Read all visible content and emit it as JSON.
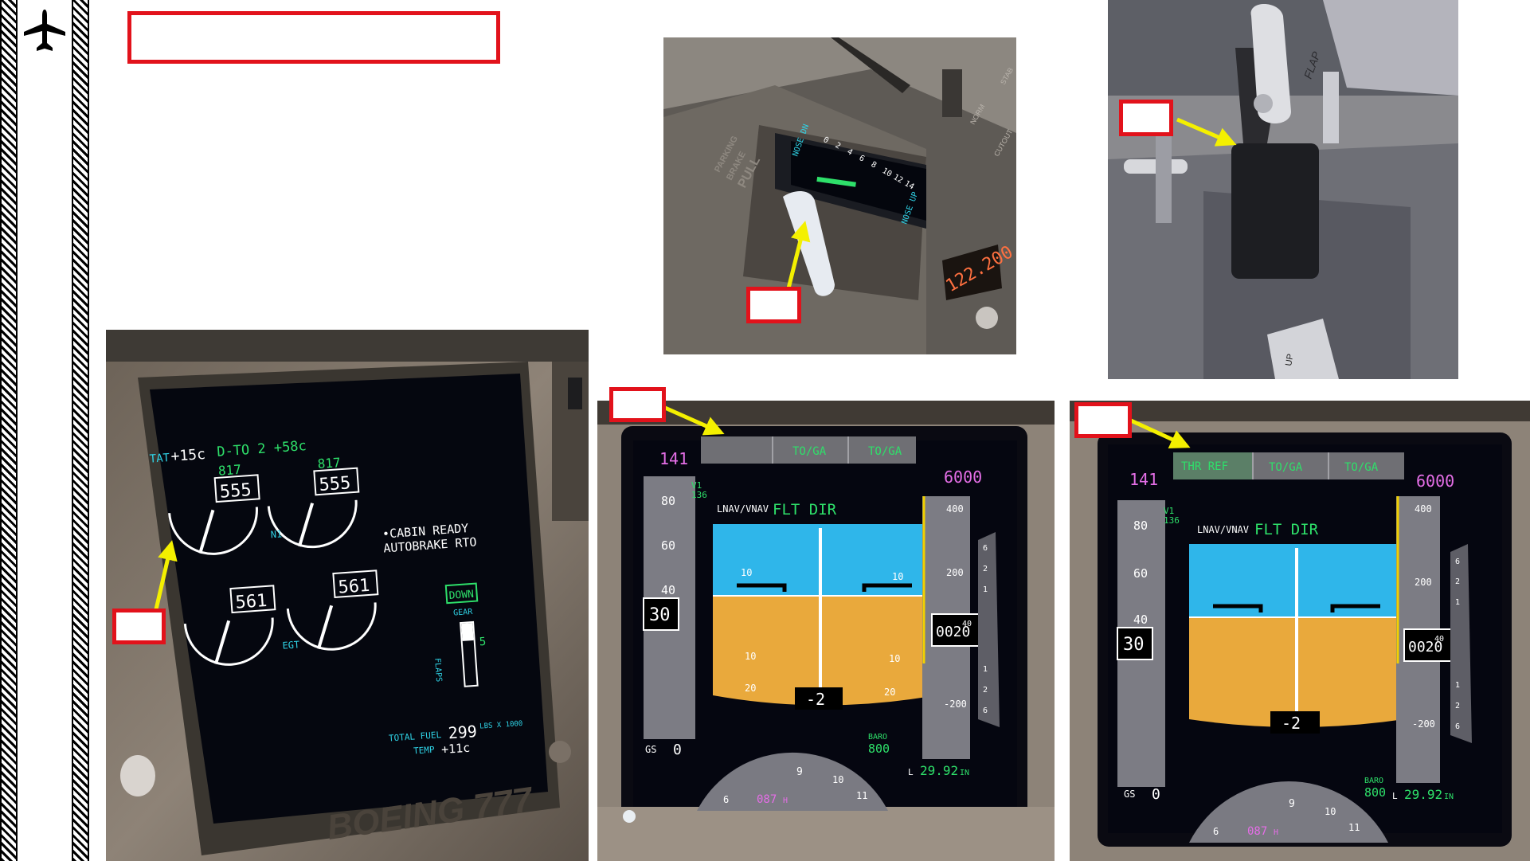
{
  "eicas": {
    "tat_label": "TAT",
    "tat_value": "+15c",
    "thrust_mode": "D-TO 2 +58c",
    "n1_ref_left": "817",
    "n1_left": "555",
    "n1_ref_right": "817",
    "n1_right": "555",
    "n1_label": "N1",
    "egt_left": "561",
    "egt_right": "561",
    "egt_label": "EGT",
    "messages": [
      "•CABIN READY",
      "AUTOBRAKE RTO"
    ],
    "gear_status": "DOWN",
    "gear_label": "GEAR",
    "flaps_label": "FLAPS",
    "flaps_value": "5",
    "total_fuel_label": "TOTAL FUEL",
    "total_fuel_value": "299",
    "fuel_units": "LBS X 1000",
    "temp_label": "TEMP",
    "temp_value": "+11c",
    "bezel_text": "BOEING 777"
  },
  "trim_panel": {
    "placard": [
      "PARKING",
      "BRAKE",
      "PULL"
    ],
    "nose_dn": "NOSE DN",
    "nose_up": "NOSE UP",
    "scale": [
      "0",
      "2",
      "4",
      "6",
      "8",
      "10",
      "12",
      "14"
    ],
    "freq_display": "122.200",
    "labels": [
      "NORM",
      "CUTOUT",
      "STAB"
    ]
  },
  "throttle": {
    "flap_label": "FLAP",
    "label_right": "UP"
  },
  "pfd_left": {
    "fma": [
      "",
      "TO/GA",
      "TO/GA"
    ],
    "selected_speed": "141",
    "selected_alt": "6000",
    "mode": "LNAV/VNAV",
    "flt_dir": "FLT DIR",
    "v1_label": "V1",
    "v1_value": "136",
    "speed_ticks": [
      "80",
      "60",
      "40"
    ],
    "speed_current": "30",
    "alt_ticks": [
      "400",
      "200",
      "-200"
    ],
    "alt_current": "0020",
    "alt_hundreds": "40",
    "pitch_labels": [
      "10",
      "10",
      "10",
      "10",
      "20",
      "20"
    ],
    "vs_value": "-2",
    "gs_label": "GS",
    "gs_value": "0",
    "baro_label": "BARO",
    "baro_value": "800",
    "altimeter": "29.92",
    "altimeter_unit": "IN",
    "altimeter_prefix": "L",
    "heading": "087",
    "heading_suffix": "H",
    "compass_marks": [
      "6",
      "9",
      "10",
      "11"
    ],
    "vsi_ticks": [
      "6",
      "2",
      "1",
      "1",
      "2",
      "6"
    ]
  },
  "pfd_right": {
    "fma": [
      "THR REF",
      "TO/GA",
      "TO/GA"
    ],
    "selected_speed": "141",
    "selected_alt": "6000",
    "mode": "LNAV/VNAV",
    "flt_dir": "FLT DIR",
    "v1_label": "V1",
    "v1_value": "136",
    "speed_ticks": [
      "80",
      "60",
      "40"
    ],
    "speed_current": "30",
    "alt_ticks": [
      "400",
      "200",
      "-200"
    ],
    "alt_current": "0020",
    "alt_hundreds": "40",
    "vs_value": "-2",
    "gs_label": "GS",
    "gs_value": "0",
    "baro_label": "BARO",
    "baro_value": "800",
    "altimeter": "29.92",
    "altimeter_unit": "IN",
    "altimeter_prefix": "L",
    "heading": "087",
    "heading_suffix": "H",
    "compass_marks": [
      "6",
      "9",
      "10",
      "11"
    ],
    "vsi_ticks": [
      "6",
      "2",
      "1",
      "1",
      "2",
      "6"
    ]
  },
  "colors": {
    "callout_red": "#e2121b",
    "arrow_yellow": "#f4f000",
    "sky": "#2fb6ea",
    "ground": "#e9a93c",
    "magenta": "#e46ee6",
    "green": "#2ee06a",
    "cyan": "#2fd3e6"
  },
  "icons": [
    "airplane-icon"
  ]
}
